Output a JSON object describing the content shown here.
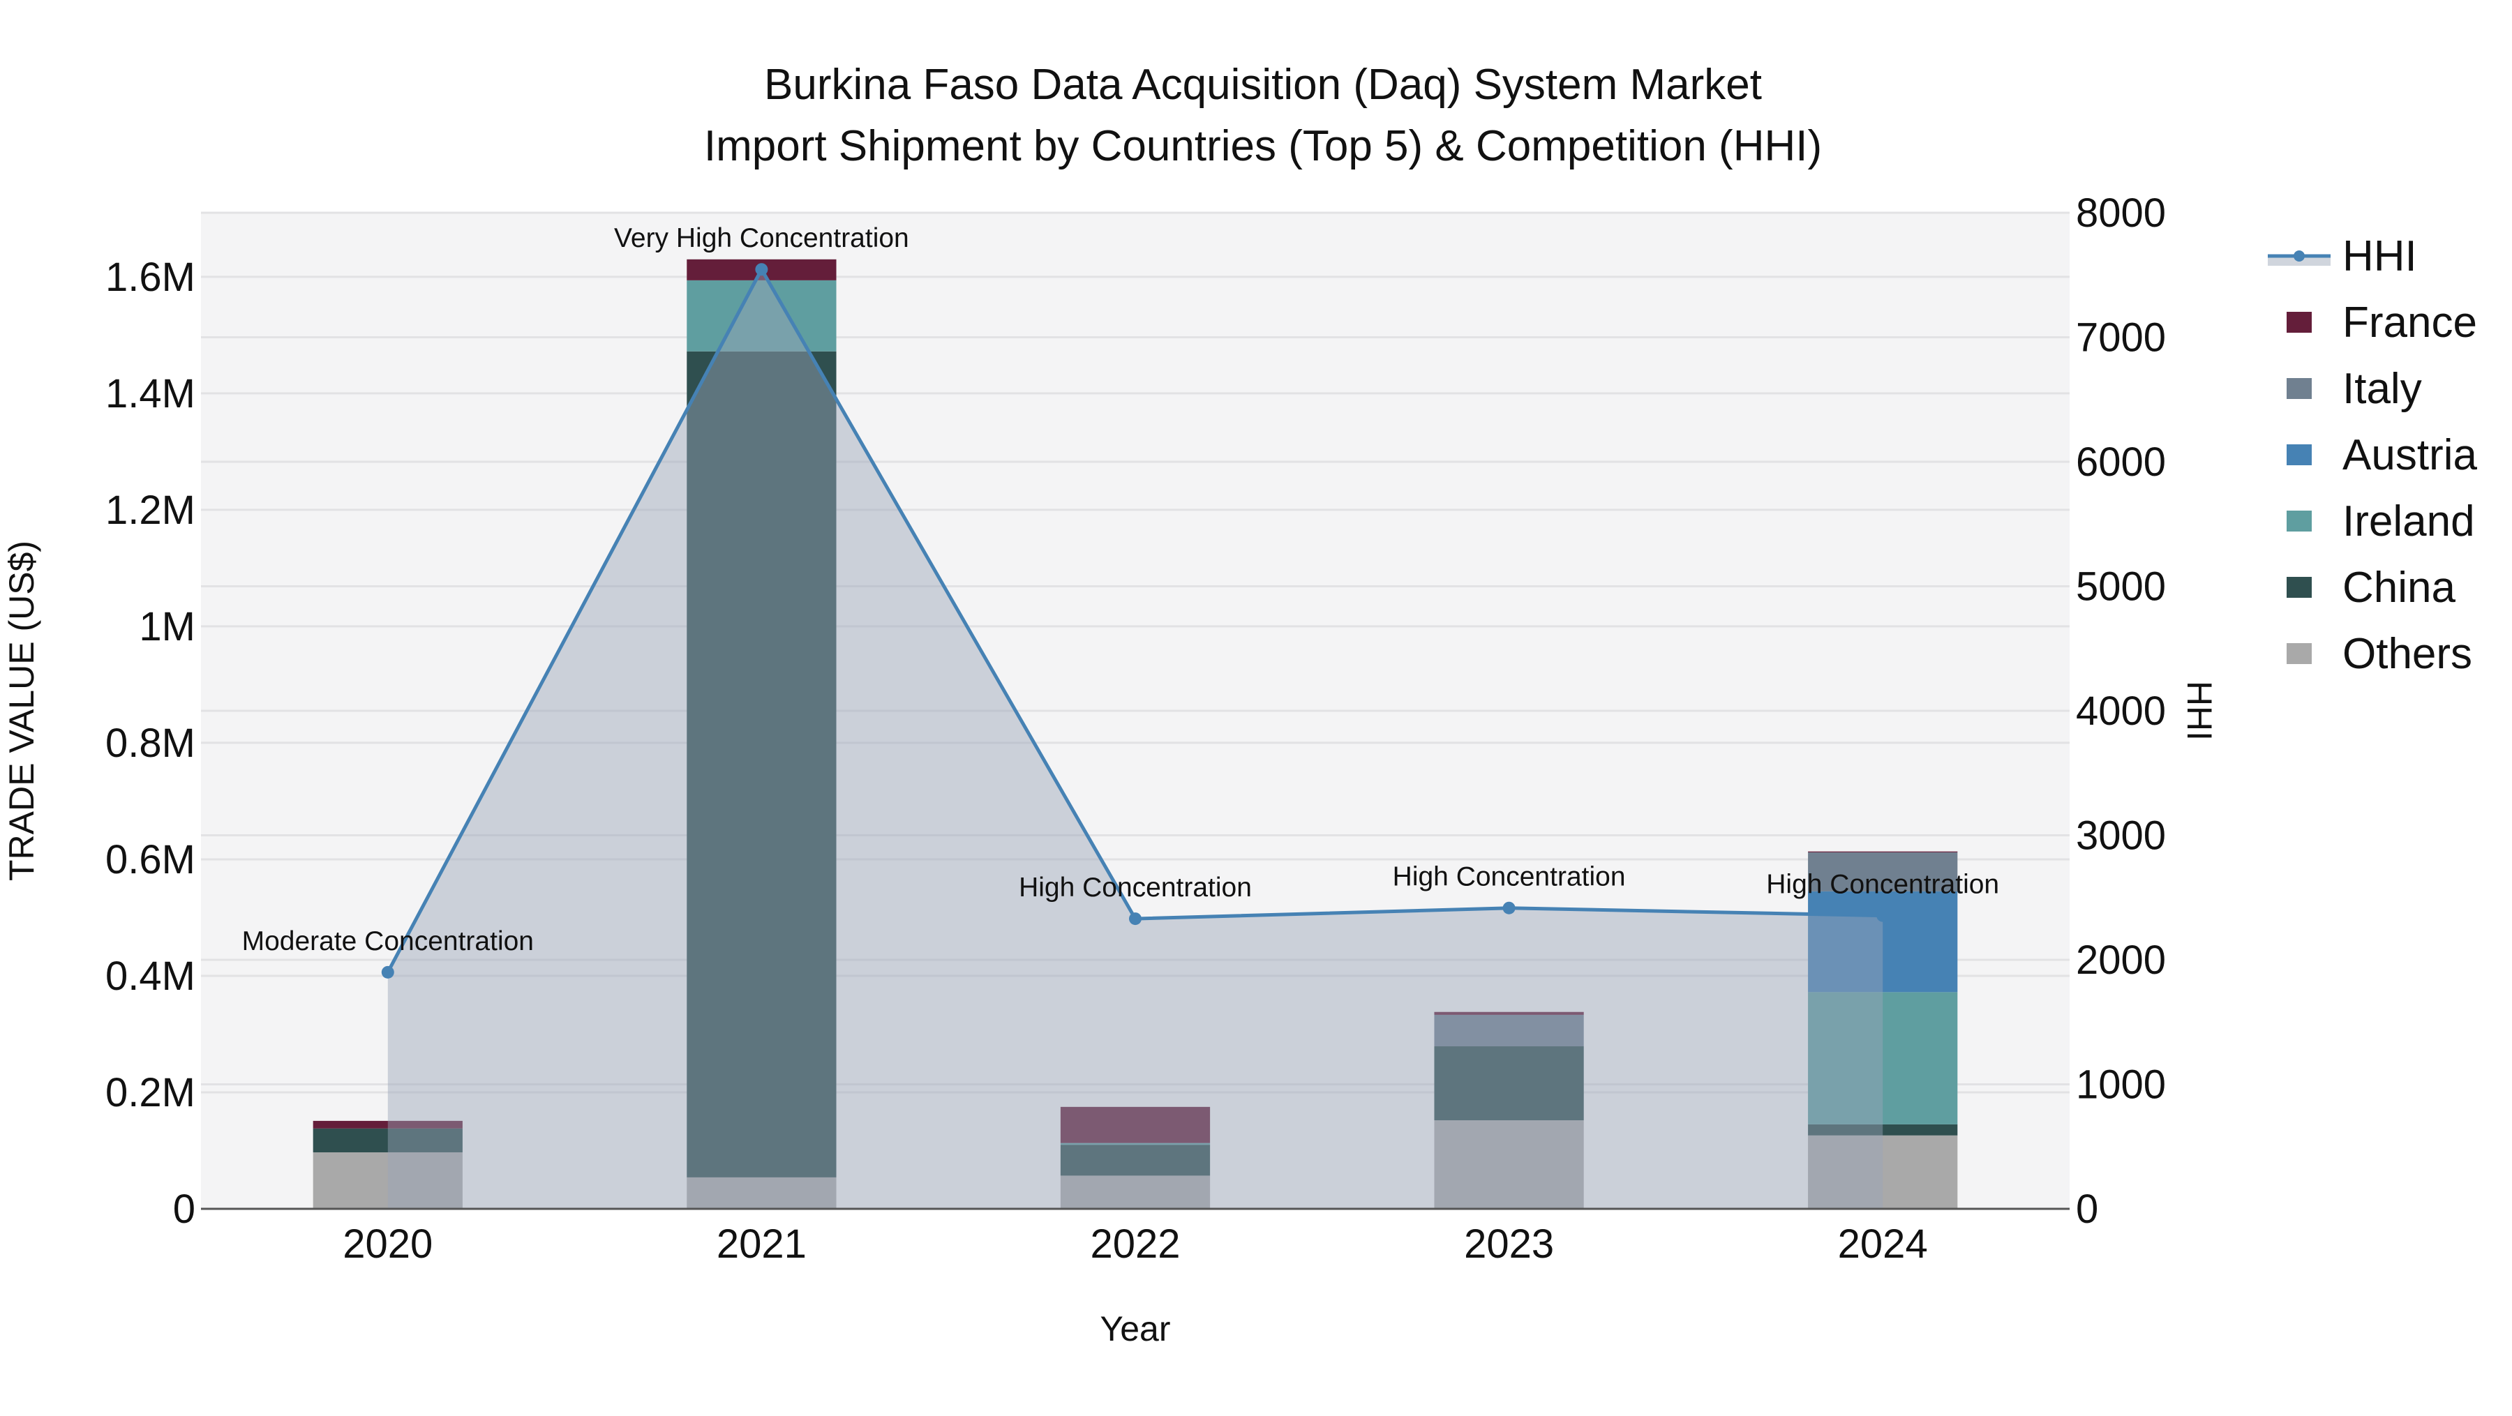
{
  "chart_data": {
    "type": "bar",
    "title_lines": [
      "Burkina Faso Data Acquisition (Daq) System Market",
      "Import Shipment by Countries (Top 5) & Competition (HHI)"
    ],
    "xlabel": "Year",
    "ylabel": "TRADE VALUE (US$)",
    "y2label": "HHI",
    "categories": [
      "2020",
      "2021",
      "2022",
      "2023",
      "2024"
    ],
    "stacked": true,
    "ylim": [
      0,
      1710000
    ],
    "y2lim": [
      0,
      8000
    ],
    "yticks": [
      0,
      200000,
      400000,
      600000,
      800000,
      1000000,
      1200000,
      1400000,
      1600000
    ],
    "ytick_labels": [
      "0",
      "0.2M",
      "0.4M",
      "0.6M",
      "0.8M",
      "1M",
      "1.2M",
      "1.4M",
      "1.6M"
    ],
    "y2ticks": [
      0,
      1000,
      2000,
      3000,
      4000,
      5000,
      6000,
      7000,
      8000
    ],
    "y2tick_labels": [
      "0",
      "1000",
      "2000",
      "3000",
      "4000",
      "5000",
      "6000",
      "7000",
      "8000"
    ],
    "grid": true,
    "legend_position": "right",
    "series": [
      {
        "name": "Others",
        "color": "#A9A9A9",
        "values": [
          97000,
          54000,
          57000,
          152000,
          126000
        ]
      },
      {
        "name": "China",
        "color": "#2F4F4F",
        "values": [
          41000,
          1418000,
          53000,
          127000,
          19000
        ]
      },
      {
        "name": "Ireland",
        "color": "#5F9EA0",
        "values": [
          0,
          122000,
          3000,
          0,
          227000
        ]
      },
      {
        "name": "Austria",
        "color": "#4682B4",
        "values": [
          0,
          0,
          0,
          0,
          173000
        ]
      },
      {
        "name": "Italy",
        "color": "#708090",
        "values": [
          0,
          0,
          0,
          54000,
          67000
        ]
      },
      {
        "name": "France",
        "color": "#641E3A",
        "values": [
          13000,
          36000,
          62000,
          5000,
          1500
        ]
      }
    ],
    "hhi": {
      "name": "HHI",
      "color": "#4682B4",
      "fill_color": "#9AA5B8",
      "values": [
        1900,
        7545,
        2330,
        2416,
        2355
      ],
      "annotations": [
        "Moderate Concentration",
        "Very High Concentration",
        "High Concentration",
        "High Concentration",
        "High Concentration"
      ]
    },
    "legend_order": [
      "HHI",
      "France",
      "Italy",
      "Austria",
      "Ireland",
      "China",
      "Others"
    ]
  }
}
